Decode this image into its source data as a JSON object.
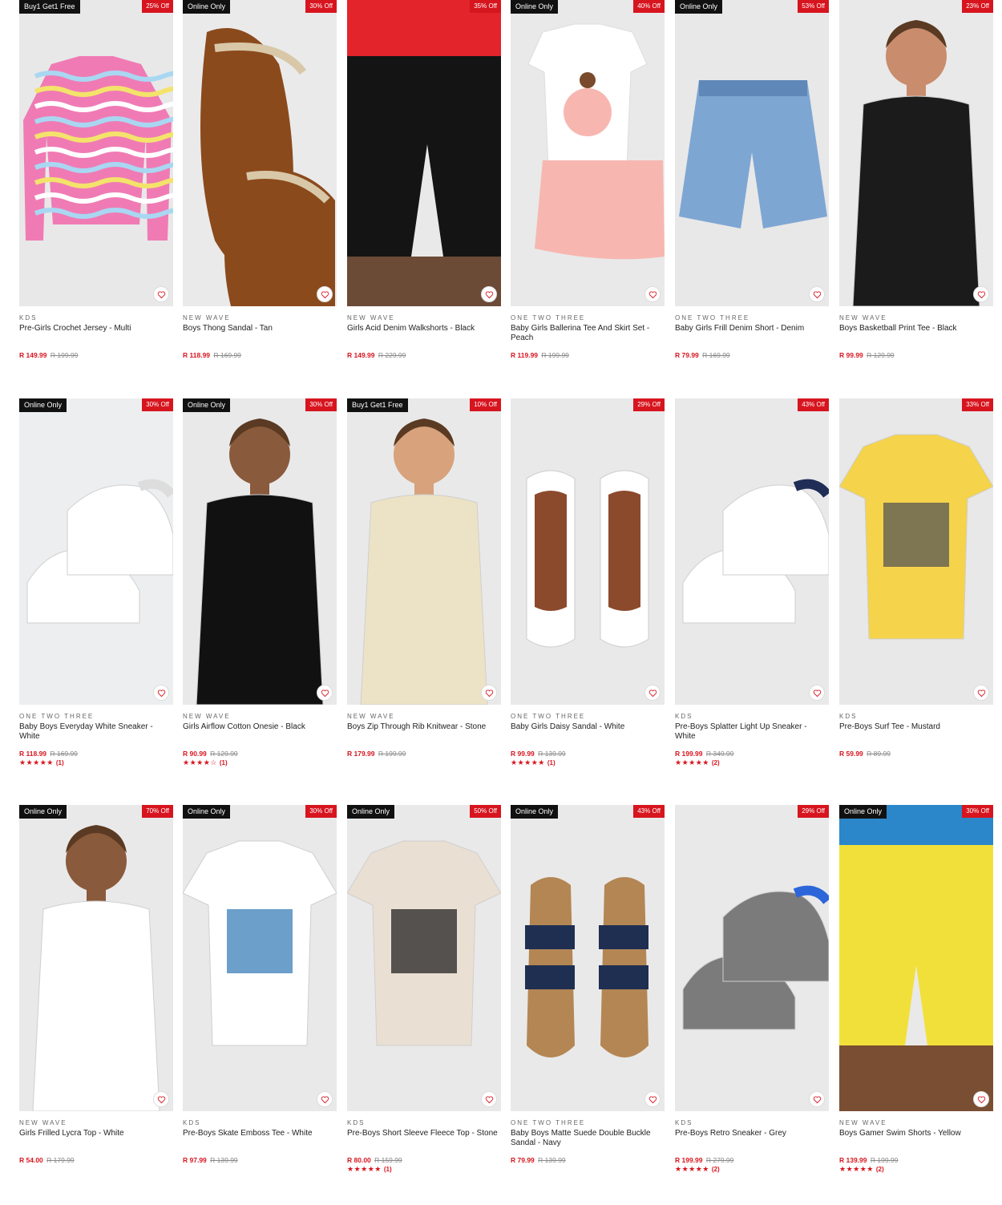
{
  "products": [
    {
      "brand": "KDS",
      "name": "Pre-Girls Crochet Jersey - Multi",
      "price": "R 149.99",
      "was": "R 199.99",
      "badge": "Buy1 Get1 Free",
      "discount": "25% Off",
      "bg": "#e8e8e8",
      "art": "sweater",
      "c1": "#f07bb4",
      "c2": "#a9d7f2",
      "rating": "",
      "reviews": ""
    },
    {
      "brand": "NEW WAVE",
      "name": "Boys Thong Sandal - Tan",
      "price": "R 118.99",
      "was": "R 169.99",
      "badge": "Online Only",
      "discount": "30% Off",
      "bg": "#eaeaea",
      "art": "flipflop",
      "c1": "#8b4a1c",
      "c2": "#d8c8a8",
      "rating": "",
      "reviews": ""
    },
    {
      "brand": "NEW WAVE",
      "name": "Girls Acid Denim Walkshorts - Black",
      "price": "R 149.99",
      "was": "R 229.99",
      "badge": "",
      "discount": "35% Off",
      "bg": "#e9e9e9",
      "art": "walkshort",
      "c1": "#141414",
      "c2": "#e3242b",
      "rating": "",
      "reviews": ""
    },
    {
      "brand": "ONE TWO THREE",
      "name": "Baby Girls Ballerina Tee And Skirt Set - Peach",
      "price": "R 119.99",
      "was": "R 199.99",
      "badge": "Online Only",
      "discount": "40% Off",
      "bg": "#e9e9e9",
      "art": "teeskirt",
      "c1": "#ffffff",
      "c2": "#f7b7b0",
      "rating": "",
      "reviews": ""
    },
    {
      "brand": "ONE TWO THREE",
      "name": "Baby Girls Frill Denim Short - Denim",
      "price": "R 79.99",
      "was": "R 169.99",
      "badge": "Online Only",
      "discount": "53% Off",
      "bg": "#e8e8e8",
      "art": "shorts",
      "c1": "#7ea6d3",
      "c2": "#5f88b9",
      "rating": "",
      "reviews": ""
    },
    {
      "brand": "NEW WAVE",
      "name": "Boys Basketball Print Tee - Black",
      "price": "R 99.99",
      "was": "R 129.99",
      "badge": "",
      "discount": "23% Off",
      "bg": "#e9e9e9",
      "art": "person",
      "c1": "#1b1b1b",
      "c2": "#c98c6d",
      "rating": "",
      "reviews": ""
    },
    {
      "brand": "ONE TWO THREE",
      "name": "Baby Boys Everyday White Sneaker - White",
      "price": "R 118.99",
      "was": "R 169.99",
      "badge": "Online Only",
      "discount": "30% Off",
      "bg": "#eceeef",
      "art": "sneakers",
      "c1": "#ffffff",
      "c2": "#dddddd",
      "rating": "★★★★★",
      "reviews": "(1)"
    },
    {
      "brand": "NEW WAVE",
      "name": "Girls Airflow Cotton Onesie - Black",
      "price": "R 90.99",
      "was": "R 129.99",
      "badge": "Online Only",
      "discount": "30% Off",
      "bg": "#e9e9e9",
      "art": "person",
      "c1": "#111111",
      "c2": "#8a5a3c",
      "rating": "★★★★☆",
      "reviews": "(1)"
    },
    {
      "brand": "NEW WAVE",
      "name": "Boys Zip Through Rib Knitwear - Stone",
      "price": "R 179.99",
      "was": "R 199.99",
      "badge": "Buy1 Get1 Free",
      "discount": "10% Off",
      "bg": "#e9e9e9",
      "art": "person",
      "c1": "#ece2c5",
      "c2": "#d7a27c",
      "rating": "",
      "reviews": ""
    },
    {
      "brand": "ONE TWO THREE",
      "name": "Baby Girls Daisy Sandal - White",
      "price": "R 99.99",
      "was": "R 139.99",
      "badge": "",
      "discount": "29% Off",
      "bg": "#e9e9e9",
      "art": "sandals",
      "c1": "#ffffff",
      "c2": "#8c4a2c",
      "rating": "★★★★★",
      "reviews": "(1)"
    },
    {
      "brand": "KDS",
      "name": "Pre-Boys Splatter Light Up Sneaker - White",
      "price": "R 199.99",
      "was": "R 349.99",
      "badge": "",
      "discount": "43% Off",
      "bg": "#e9e9e9",
      "art": "sneakers",
      "c1": "#ffffff",
      "c2": "#1f2d57",
      "rating": "★★★★★",
      "reviews": "(2)"
    },
    {
      "brand": "KDS",
      "name": "Pre-Boys Surf Tee - Mustard",
      "price": "R 59.99",
      "was": "R 89.99",
      "badge": "",
      "discount": "33% Off",
      "bg": "#e8e8e8",
      "art": "tee",
      "c1": "#f5d34a",
      "c2": "#555555",
      "rating": "",
      "reviews": ""
    },
    {
      "brand": "NEW WAVE",
      "name": "Girls Frilled Lycra Top - White",
      "price": "R 54.00",
      "was": "R 179.99",
      "badge": "Online Only",
      "discount": "70% Off",
      "bg": "#e9e9e9",
      "art": "person",
      "c1": "#ffffff",
      "c2": "#8a5a3c",
      "rating": "",
      "reviews": ""
    },
    {
      "brand": "KDS",
      "name": "Pre-Boys Skate Emboss Tee - White",
      "price": "R 97.99",
      "was": "R 139.99",
      "badge": "Online Only",
      "discount": "30% Off",
      "bg": "#e9e9e9",
      "art": "tee",
      "c1": "#ffffff",
      "c2": "#3b7fb8",
      "rating": "",
      "reviews": ""
    },
    {
      "brand": "KDS",
      "name": "Pre-Boys Short Sleeve Fleece Top - Stone",
      "price": "R 80.00",
      "was": "R 159.99",
      "badge": "Online Only",
      "discount": "50% Off",
      "bg": "#e9e9e9",
      "art": "tee",
      "c1": "#eadfd3",
      "c2": "#222222",
      "rating": "★★★★★",
      "reviews": "(1)"
    },
    {
      "brand": "ONE TWO THREE",
      "name": "Baby Boys Matte Suede Double Buckle Sandal - Navy",
      "price": "R 79.99",
      "was": "R 139.99",
      "badge": "Online Only",
      "discount": "43% Off",
      "bg": "#e9e9e9",
      "art": "buckle",
      "c1": "#1f2f52",
      "c2": "#b48654",
      "rating": "",
      "reviews": ""
    },
    {
      "brand": "KDS",
      "name": "Pre-Boys Retro Sneaker - Grey",
      "price": "R 199.99",
      "was": "R 279.99",
      "badge": "",
      "discount": "29% Off",
      "bg": "#e9e9e9",
      "art": "sneakers",
      "c1": "#7b7b7b",
      "c2": "#2d66d8",
      "rating": "★★★★★",
      "reviews": "(2)"
    },
    {
      "brand": "NEW WAVE",
      "name": "Boys Gamer Swim Shorts - Yellow",
      "price": "R 139.99",
      "was": "R 199.99",
      "badge": "Online Only",
      "discount": "30% Off",
      "bg": "#e9e9e9",
      "art": "swim",
      "c1": "#f2e03a",
      "c2": "#2b87c9",
      "rating": "★★★★★",
      "reviews": "(2)"
    }
  ]
}
